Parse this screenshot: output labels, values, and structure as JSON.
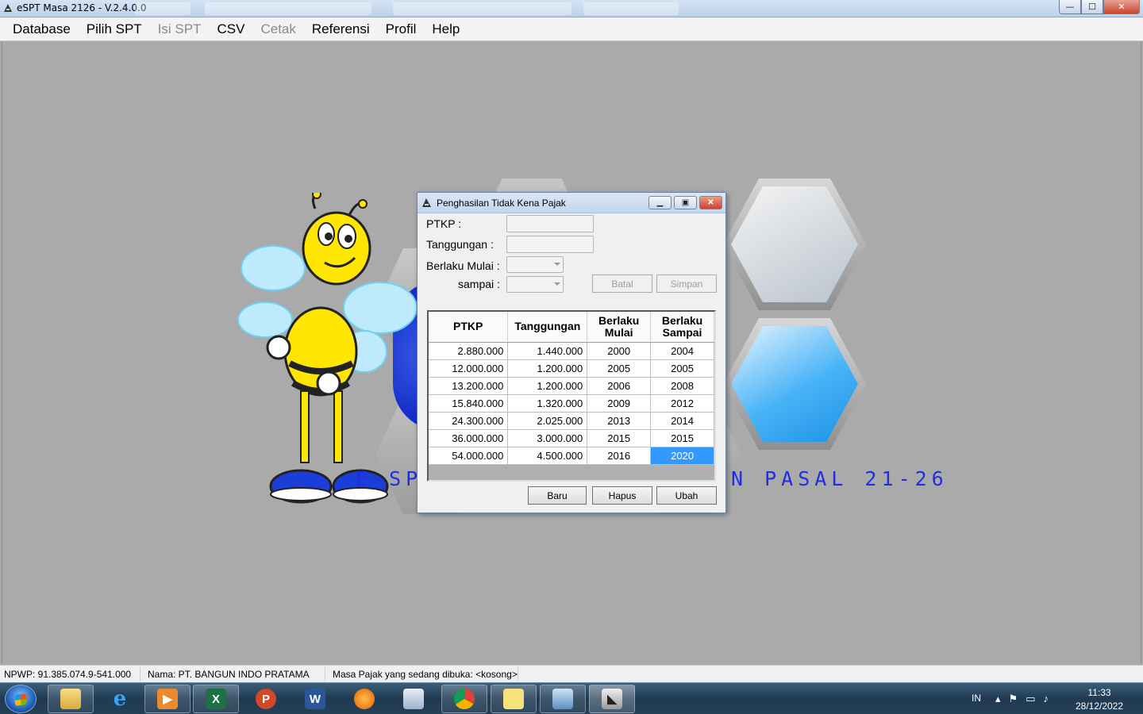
{
  "window": {
    "title": "eSPT Masa 2126 - V.2.4.0.0",
    "min": "—",
    "max": "☐",
    "close": "✕"
  },
  "menu": [
    "Database",
    "Pilih SPT",
    "Isi SPT",
    "CSV",
    "Cetak",
    "Referensi",
    "Profil",
    "Help"
  ],
  "menu_disabled": [
    false,
    false,
    true,
    false,
    true,
    false,
    false,
    false
  ],
  "logo": {
    "left_text": "E-SPT",
    "right_text": "N PASAL 21-26"
  },
  "dialog": {
    "title": "Penghasilan Tidak Kena Pajak",
    "labels": {
      "ptkp": "PTKP :",
      "tanggungan": "Tanggungan :",
      "berlaku_mulai": "Berlaku Mulai :",
      "sampai": "sampai :"
    },
    "buttons": {
      "batal": "Batal",
      "simpan": "Simpan",
      "baru": "Baru",
      "hapus": "Hapus",
      "ubah": "Ubah"
    },
    "table": {
      "headers": [
        "PTKP",
        "Tanggungan",
        "Berlaku Mulai",
        "Berlaku Sampai"
      ],
      "rows": [
        [
          "2.880.000",
          "1.440.000",
          "2000",
          "2004"
        ],
        [
          "12.000.000",
          "1.200.000",
          "2005",
          "2005"
        ],
        [
          "13.200.000",
          "1.200.000",
          "2006",
          "2008"
        ],
        [
          "15.840.000",
          "1.320.000",
          "2009",
          "2012"
        ],
        [
          "24.300.000",
          "2.025.000",
          "2013",
          "2014"
        ],
        [
          "36.000.000",
          "3.000.000",
          "2015",
          "2015"
        ],
        [
          "54.000.000",
          "4.500.000",
          "2016",
          "2020"
        ]
      ],
      "selected_cell": "2020"
    }
  },
  "status": {
    "npwp": "NPWP: 91.385.074.9-541.000",
    "nama": "Nama: PT. BANGUN INDO PRATAMA",
    "masa": "Masa Pajak yang sedang dibuka: <kosong>"
  },
  "taskbar": {
    "apps": [
      "file-explorer",
      "internet-explorer",
      "media-player",
      "excel",
      "powerpoint",
      "word",
      "firefox",
      "network-tool",
      "chrome",
      "sticky-notes",
      "control-panel",
      "espt"
    ],
    "language": "IN",
    "time": "11:33",
    "date": "28/12/2022"
  }
}
